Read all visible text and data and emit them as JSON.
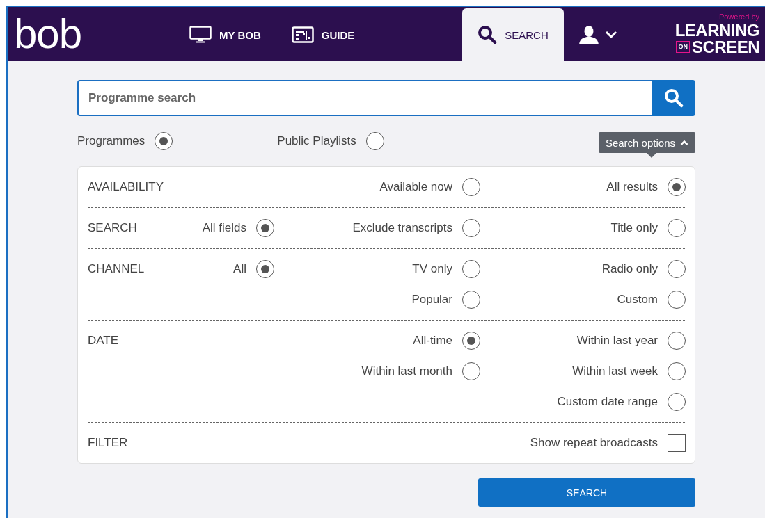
{
  "header": {
    "logo": "bob",
    "nav": [
      {
        "label": "MY BOB",
        "kind": "monitor",
        "selected": false
      },
      {
        "label": "GUIDE",
        "kind": "guide",
        "selected": false
      },
      {
        "label": "SEARCH",
        "kind": "search",
        "selected": true
      }
    ],
    "brand": {
      "tagline": "Powered by",
      "line_1": "LEARNING",
      "badge": "ON",
      "line_2": "SCREEN"
    }
  },
  "search": {
    "placeholder": "Programme search"
  },
  "scope": [
    {
      "label": "Programmes",
      "selected": true
    },
    {
      "label": "Public Playlists",
      "selected": false
    }
  ],
  "options_toggle": {
    "label": "Search options",
    "expanded": true
  },
  "sections": [
    {
      "label": "AVAILABILITY",
      "rows": [
        [
          null,
          {
            "kind": "radio",
            "label": "Available now",
            "selected": false
          },
          {
            "kind": "radio",
            "label": "All results",
            "selected": true
          }
        ]
      ]
    },
    {
      "label": "SEARCH",
      "rows": [
        [
          {
            "kind": "radio",
            "label": "All fields",
            "selected": true
          },
          {
            "kind": "radio",
            "label": "Exclude transcripts",
            "selected": false
          },
          {
            "kind": "radio",
            "label": "Title only",
            "selected": false
          }
        ]
      ]
    },
    {
      "label": "CHANNEL",
      "rows": [
        [
          {
            "kind": "radio",
            "label": "All",
            "selected": true
          },
          {
            "kind": "radio",
            "label": "TV only",
            "selected": false
          },
          {
            "kind": "radio",
            "label": "Radio only",
            "selected": false
          }
        ],
        [
          null,
          {
            "kind": "radio",
            "label": "Popular",
            "selected": false
          },
          {
            "kind": "radio",
            "label": "Custom",
            "selected": false
          }
        ]
      ]
    },
    {
      "label": "DATE",
      "rows": [
        [
          null,
          {
            "kind": "radio",
            "label": "All-time",
            "selected": true
          },
          {
            "kind": "radio",
            "label": "Within last year",
            "selected": false
          }
        ],
        [
          null,
          {
            "kind": "radio",
            "label": "Within last month",
            "selected": false
          },
          {
            "kind": "radio",
            "label": "Within last week",
            "selected": false
          }
        ],
        [
          null,
          null,
          {
            "kind": "radio",
            "label": "Custom date range",
            "selected": false
          }
        ]
      ]
    },
    {
      "label": "FILTER",
      "rows": [
        [
          null,
          null,
          {
            "kind": "checkbox",
            "label": "Show repeat broadcasts",
            "checked": false
          }
        ]
      ]
    }
  ],
  "submit": "SEARCH"
}
